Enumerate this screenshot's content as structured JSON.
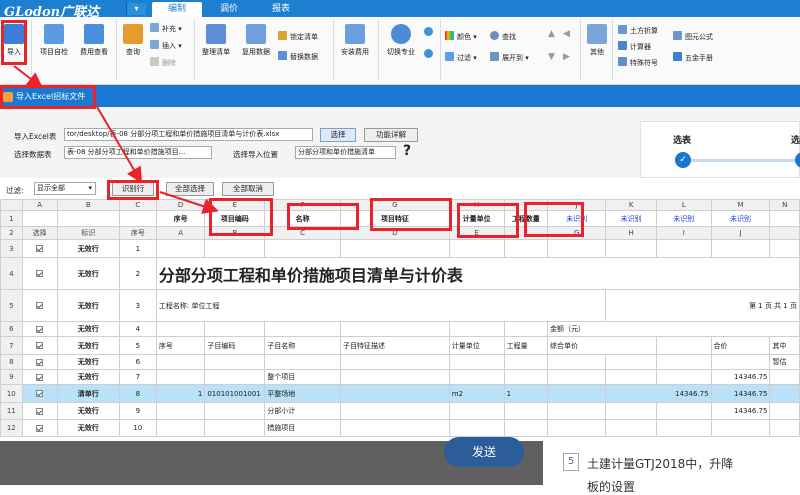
{
  "app": {
    "logo": "GLodon广联达",
    "dropdown": "▾",
    "tabs": [
      "编制",
      "调价",
      "报表"
    ]
  },
  "ribbon": {
    "import": "导入",
    "project_check": "项目自检",
    "fee_check": "费用查看",
    "query": "查询",
    "supplement": "补充",
    "insert": "插入",
    "delete": "删除",
    "organize_list": "整理清单",
    "copy_data": "复用数据",
    "lock_list": "锁定清单",
    "replace_data": "替换数据",
    "install_fee": "安装费用",
    "switch_major": "切换专业",
    "color": "颜色",
    "find": "查找",
    "filter": "过滤",
    "expand": "展开到",
    "other": "其他",
    "earth_calc": "土方折算",
    "calculator": "计算器",
    "special_symbol": "特殊符号",
    "figure_formula": "图元公式",
    "hardware_manual": "五金手册"
  },
  "dialog": {
    "title": "导入Excel招标文件",
    "import_excel_label": "导入Excel表",
    "import_excel_path": "tor/desktop/表-08 分部分项工程和单价措施项目清单与计价表.xlsx",
    "select_btn": "选择",
    "feature_detail_btn": "功能详解",
    "select_table_label": "选择数据表",
    "select_table_value": "表-08 分部分项工程和单价措施项目...",
    "import_pos_label": "选择导入位置",
    "import_pos_value": "分部分项和单价措施清单",
    "help": "?",
    "wizard_step": "选表",
    "wizard_next": "选"
  },
  "filter": {
    "label": "过滤:",
    "value": "显示全部",
    "identify_btn": "识别行",
    "select_all_btn": "全部选择",
    "cancel_all_btn": "全部取消"
  },
  "grid": {
    "col_letters": [
      "",
      "A",
      "B",
      "C",
      "D",
      "E",
      "F",
      "G",
      "H",
      "I",
      "J",
      "K",
      "L",
      "M",
      "N"
    ],
    "row1": [
      "1",
      "",
      "",
      "",
      "序号",
      "项目编码",
      "名称",
      "项目特征",
      "计量单位",
      "工程数量",
      "未识别",
      "未识别",
      "未识别",
      "未识别",
      ""
    ],
    "row2": [
      "2",
      "选择",
      "标识",
      "序号",
      "A",
      "B",
      "C",
      "D",
      "E",
      "F",
      "G",
      "H",
      "I",
      "J",
      ""
    ],
    "rows": [
      {
        "n": "3",
        "mark": "无效行",
        "seq": "1"
      },
      {
        "n": "4",
        "mark": "无效行",
        "seq": "2",
        "title": "分部分项工程和单价措施项目清单与计价表"
      },
      {
        "n": "5",
        "mark": "无效行",
        "seq": "3",
        "proj": "工程名称: 单位工程",
        "page": "第 1 页 共 1 页"
      },
      {
        "n": "6",
        "mark": "无效行",
        "seq": "4",
        "amount": "金额（元）"
      },
      {
        "n": "7",
        "mark": "无效行",
        "seq": "5",
        "h1": "序号",
        "h2": "子目编码",
        "h3": "子目名称",
        "h4": "子目特征描述",
        "h5": "计量单位",
        "h6": "工程量",
        "h7": "综合单价",
        "h8": "合价",
        "h9": "其中"
      },
      {
        "n": "8",
        "mark": "无效行",
        "seq": "6",
        "h9": "暂估"
      },
      {
        "n": "9",
        "mark": "无效行",
        "seq": "7",
        "name": "整个项目",
        "total": "14346.75"
      },
      {
        "n": "10",
        "mark": "清单行",
        "seq": "8",
        "idx": "1",
        "code": "010101001001",
        "name": "平整场地",
        "unit": "m2",
        "qty": "1",
        "price": "14346.75",
        "total": "14346.75"
      },
      {
        "n": "11",
        "mark": "无效行",
        "seq": "9",
        "name": "分部小计",
        "total": "14346.75"
      },
      {
        "n": "12",
        "mark": "无效行",
        "seq": "10",
        "name": "措施项目"
      }
    ]
  },
  "chat": {
    "send": "发送",
    "num": "5",
    "line1": "土建计量GTJ2018中，升降",
    "line2": "板的设置"
  },
  "colors": {
    "brand": "#1c7fd0",
    "annotation": "#e8232a",
    "selected_row": "#b9e1f7"
  }
}
